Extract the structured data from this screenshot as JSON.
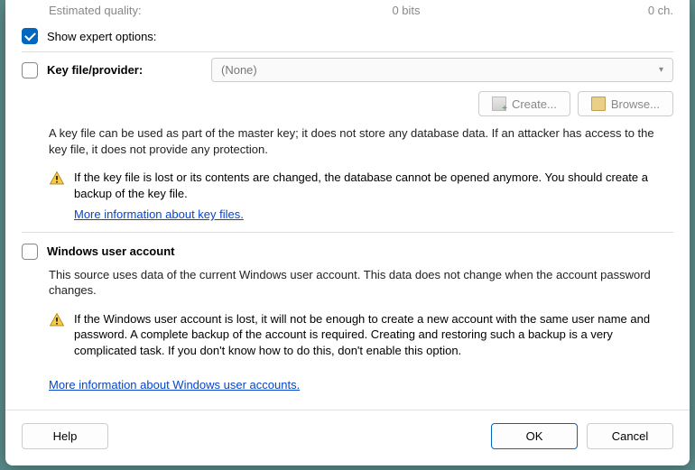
{
  "quality": {
    "label": "Estimated quality:",
    "value": "0 bits",
    "ch": "0 ch."
  },
  "expert": {
    "label": "Show expert options:",
    "checked": true
  },
  "keyfile": {
    "checked": false,
    "label": "Key file/provider:",
    "dropdown_value": "(None)",
    "create_label": "Create...",
    "browse_label": "Browse...",
    "desc": "A key file can be used as part of the master key; it does not store any database data. If an attacker has access to the key file, it does not provide any protection.",
    "warn": "If the key file is lost or its contents are changed, the database cannot be opened anymore. You should create a backup of the key file.",
    "link": "More information about key files."
  },
  "winaccount": {
    "checked": false,
    "label": "Windows user account",
    "desc": "This source uses data of the current Windows user account. This data does not change when the account password changes.",
    "warn": "If the Windows user account is lost, it will not be enough to create a new account with the same user name and password. A complete backup of the account is required. Creating and restoring such a backup is a very complicated task. If you don't know how to do this, don't enable this option.",
    "link": "More information about Windows user accounts."
  },
  "footer": {
    "help": "Help",
    "ok": "OK",
    "cancel": "Cancel"
  }
}
